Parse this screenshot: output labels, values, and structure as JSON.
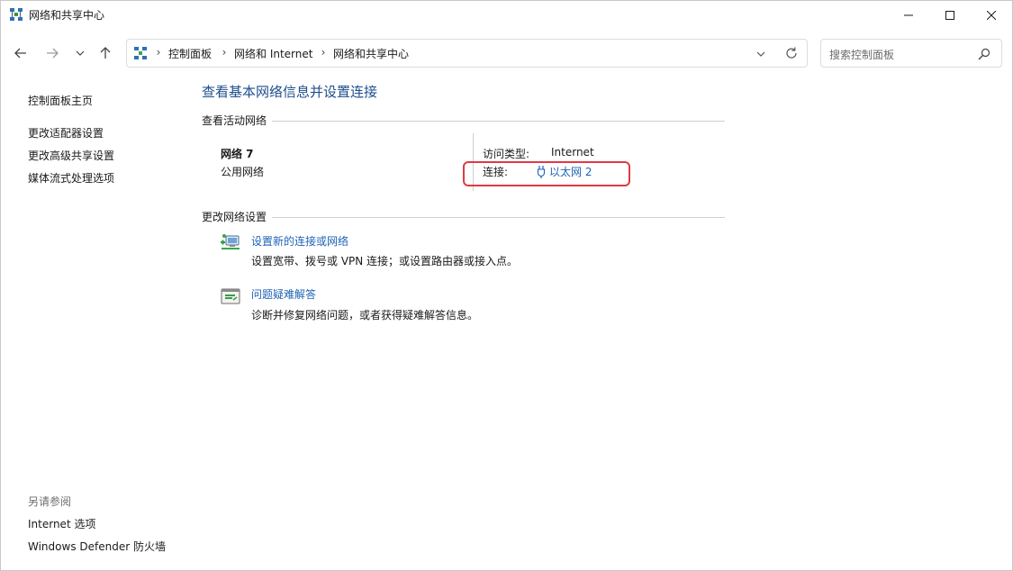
{
  "window": {
    "title": "网络和共享中心",
    "controls": {
      "minimize": "minimize-icon",
      "maximize": "maximize-icon",
      "close": "close-icon"
    }
  },
  "address": {
    "crumbs": [
      "控制面板",
      "网络和 Internet",
      "网络和共享中心"
    ],
    "search_placeholder": "搜索控制面板"
  },
  "sidebar": {
    "home": "控制面板主页",
    "links": [
      "更改适配器设置",
      "更改高级共享设置",
      "媒体流式处理选项"
    ],
    "see_also_title": "另请参阅",
    "see_also": [
      "Internet 选项",
      "Windows Defender 防火墙"
    ]
  },
  "main": {
    "title": "查看基本网络信息并设置连接",
    "active_section": "查看活动网络",
    "network": {
      "name": "网络 7",
      "category": "公用网络",
      "access_label": "访问类型:",
      "access_value": "Internet",
      "connections_label": "连接:",
      "connection_link": "以太网 2"
    },
    "change_section": "更改网络设置",
    "tasks": [
      {
        "link": "设置新的连接或网络",
        "desc": "设置宽带、拨号或 VPN 连接；或设置路由器或接入点。",
        "icon": "new-connection-icon"
      },
      {
        "link": "问题疑难解答",
        "desc": "诊断并修复网络问题，或者获得疑难解答信息。",
        "icon": "troubleshoot-icon"
      }
    ]
  },
  "colors": {
    "link": "#1f63b5",
    "title": "#1e4e8c",
    "highlight": "#e03a44"
  }
}
